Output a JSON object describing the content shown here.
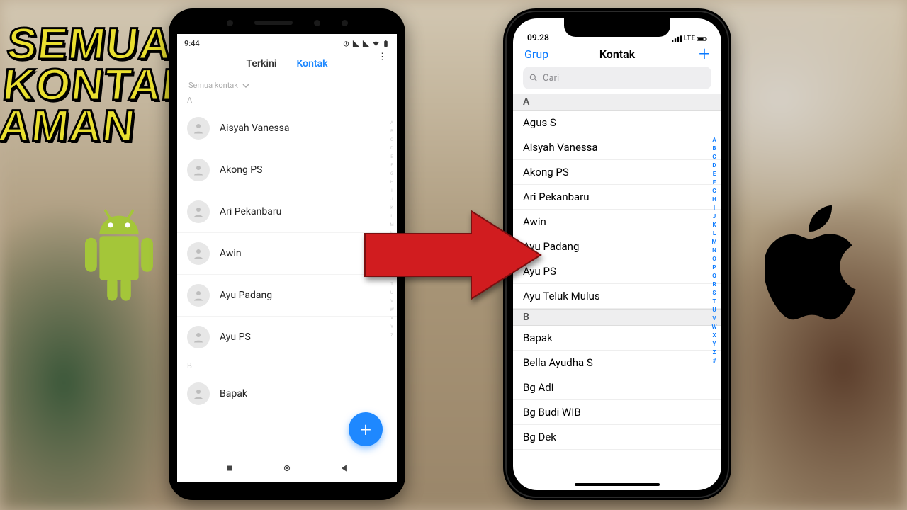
{
  "title": {
    "line1": "SEMUA",
    "line2": "KONTAK",
    "line3": "AMAN"
  },
  "android": {
    "status_time": "9:44",
    "tabs": {
      "recent": "Terkini",
      "contacts": "Kontak"
    },
    "filter_label": "Semua kontak",
    "sections": {
      "A": [
        "Aisyah Vanessa",
        "Akong PS",
        "Ari Pekanbaru",
        "Awin",
        "Ayu Padang",
        "Ayu PS"
      ],
      "B": [
        "Bapak"
      ]
    },
    "index_letters": [
      "A",
      "B",
      "C",
      "D",
      "E",
      "F",
      "G",
      "H",
      "I",
      "J",
      "K",
      "L",
      "M",
      "N",
      "O",
      "P",
      "Q",
      "R",
      "S",
      "T",
      "U",
      "V",
      "W",
      "X",
      "Y",
      "Z"
    ]
  },
  "ios": {
    "status_time": "09.28",
    "status_network": "LTE",
    "nav": {
      "group": "Grup",
      "title": "Kontak"
    },
    "search_placeholder": "Cari",
    "sections": {
      "A": [
        "Agus S",
        "Aisyah Vanessa",
        "Akong PS",
        "Ari Pekanbaru",
        "Awin",
        "Ayu Padang",
        "Ayu PS",
        "Ayu Teluk Mulus"
      ],
      "B": [
        "Bapak",
        "Bella Ayudha S",
        "Bg Adi",
        "Bg Budi WIB",
        "Bg Dek"
      ]
    },
    "index_letters": [
      "A",
      "B",
      "C",
      "D",
      "E",
      "F",
      "G",
      "H",
      "I",
      "J",
      "K",
      "L",
      "M",
      "N",
      "O",
      "P",
      "Q",
      "R",
      "S",
      "T",
      "U",
      "V",
      "W",
      "X",
      "Y",
      "Z",
      "#"
    ]
  }
}
